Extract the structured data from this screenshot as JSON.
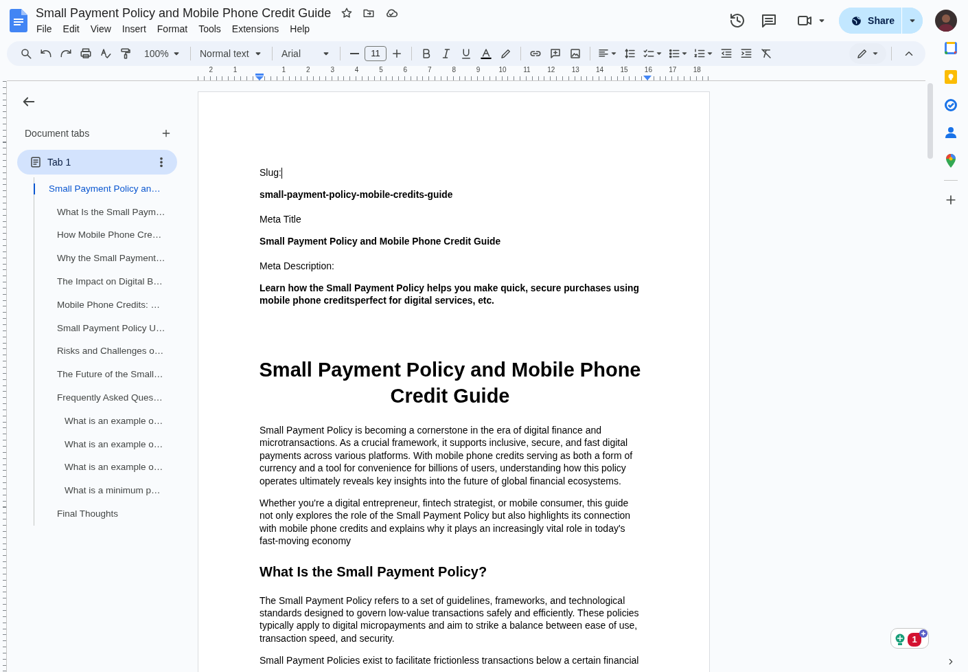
{
  "header": {
    "title": "Small Payment Policy and Mobile Phone Credit Guide",
    "menu": [
      "File",
      "Edit",
      "View",
      "Insert",
      "Format",
      "Tools",
      "Extensions",
      "Help"
    ],
    "share": "Share"
  },
  "toolbar": {
    "zoom": "100%",
    "style": "Normal text",
    "font": "Arial",
    "size": "11"
  },
  "ruler": {
    "left_labels": [
      "2",
      "1"
    ],
    "labels": [
      "1",
      "2",
      "3",
      "4",
      "5",
      "6",
      "7",
      "8",
      "9",
      "10",
      "11",
      "12",
      "13",
      "14",
      "15",
      "16",
      "17",
      "18"
    ]
  },
  "sidebar": {
    "heading": "Document tabs",
    "tabs": [
      {
        "label": "Tab 1",
        "selected": true
      }
    ],
    "outline": [
      {
        "text": "Small Payment Policy an…",
        "selected": true,
        "children": [
          {
            "text": "What Is the Small Paym…",
            "selected": false
          },
          {
            "text": "How Mobile Phone Cre…",
            "selected": false
          },
          {
            "text": "Why the Small Payment…",
            "selected": false
          },
          {
            "text": "The Impact on Digital B…",
            "selected": false
          },
          {
            "text": "Mobile Phone Credits: …",
            "selected": false
          },
          {
            "text": "Small Payment Policy U…",
            "selected": false
          },
          {
            "text": "Risks and Challenges o…",
            "selected": false
          },
          {
            "text": "The Future of the Small…",
            "selected": false
          },
          {
            "text": "Frequently Asked Ques…",
            "selected": false,
            "children": [
              {
                "text": "What is an example o…",
                "selected": false
              },
              {
                "text": "What is an example o…",
                "selected": false
              },
              {
                "text": "What is an example o…",
                "selected": false
              },
              {
                "text": "What is a minimum p…",
                "selected": false
              }
            ]
          },
          {
            "text": "Final Thoughts",
            "selected": false
          }
        ]
      }
    ]
  },
  "document": {
    "blocks": [
      {
        "kind": "label",
        "text": "Slug:",
        "cursor": true
      },
      {
        "kind": "meta",
        "text": "small-payment-policy-mobile-credits-guide"
      },
      {
        "kind": "label",
        "text": "Meta Title"
      },
      {
        "kind": "meta",
        "text": "Small Payment Policy and Mobile Phone Credit Guide"
      },
      {
        "kind": "label",
        "text": "Meta Description:"
      },
      {
        "kind": "meta",
        "text": "Learn how the Small Payment Policy helps you make quick, secure purchases using mobile phone creditsperfect for digital services, etc."
      },
      {
        "kind": "title",
        "text": "Small Payment Policy and Mobile Phone Credit Guide"
      },
      {
        "kind": "paragraph",
        "text": "Small Payment Policy is becoming a cornerstone in the era of digital finance and microtransactions. As a crucial framework, it supports inclusive, secure, and fast digital payments across various platforms. With mobile phone credits serving as both a form of currency and a tool for convenience for billions of users, understanding how this policy operates ultimately reveals key insights into the future of global financial ecosystems."
      },
      {
        "kind": "paragraph",
        "text": "Whether you're a digital entrepreneur, fintech strategist, or mobile consumer, this guide not only explores the role of the Small Payment Policy but also highlights its connection with mobile phone credits and explains why it plays an increasingly vital role in today's fast-moving economy"
      },
      {
        "kind": "heading",
        "text": "What Is the Small Payment Policy?"
      },
      {
        "kind": "paragraph",
        "text": "The Small Payment Policy refers to a set of guidelines, frameworks, and technological standards designed to govern low-value transactions safely and efficiently. These policies typically apply to digital micropayments and aim to strike a balance between ease of use, transaction speed, and security."
      },
      {
        "kind": "paragraph",
        "text": "Small Payment Policies exist to facilitate frictionless transactions below a certain financial"
      }
    ]
  },
  "notification": {
    "count": "1"
  }
}
